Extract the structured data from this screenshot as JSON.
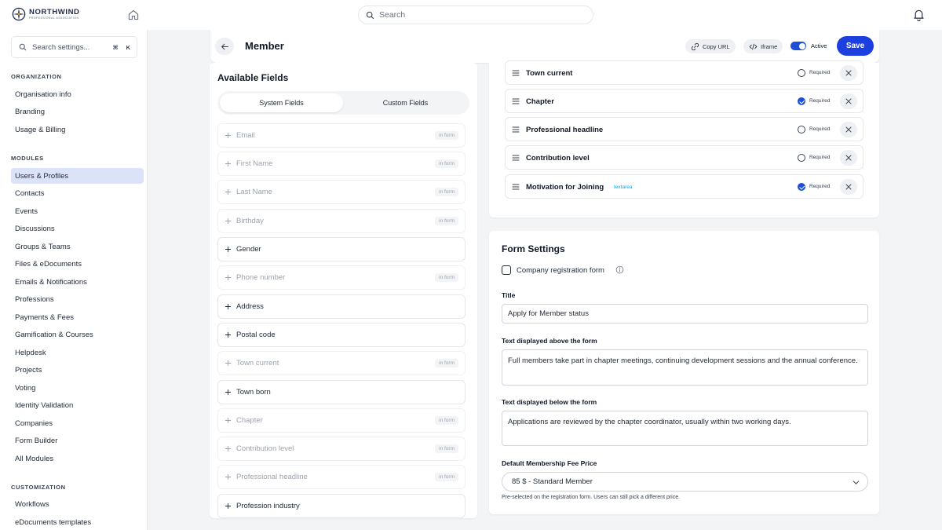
{
  "brand": {
    "name": "NORTHWIND",
    "tagline": "PROFESSIONAL ASSOCIATION"
  },
  "topbar": {
    "search_placeholder": "Search"
  },
  "sidebar": {
    "search_placeholder": "Search settings...",
    "shortcut": [
      "⌘",
      "K"
    ],
    "sections": [
      {
        "heading": "ORGANIZATION",
        "items": [
          "Organisation info",
          "Branding",
          "Usage & Billing"
        ]
      },
      {
        "heading": "MODULES",
        "items": [
          "Users & Profiles",
          "Contacts",
          "Events",
          "Discussions",
          "Groups & Teams",
          "Files & eDocuments",
          "Emails & Notifications",
          "Professions",
          "Payments & Fees",
          "Gamification & Courses",
          "Helpdesk",
          "Projects",
          "Voting",
          "Identity Validation",
          "Companies",
          "Form Builder",
          "All Modules"
        ]
      },
      {
        "heading": "CUSTOMIZATION",
        "items": [
          "Workflows",
          "eDocuments templates"
        ]
      }
    ],
    "active_item": "Users & Profiles"
  },
  "header": {
    "title": "Member",
    "copy_url_label": "Copy URL",
    "iframe_label": "Iframe",
    "active_label": "Active",
    "active": true,
    "save_label": "Save"
  },
  "available": {
    "title": "Available Fields",
    "tabs": [
      "System Fields",
      "Custom Fields"
    ],
    "active_tab": "System Fields",
    "in_form_label": "in form",
    "fields": [
      {
        "label": "Email",
        "in_form": true
      },
      {
        "label": "First Name",
        "in_form": true
      },
      {
        "label": "Last Name",
        "in_form": true
      },
      {
        "label": "Birthday",
        "in_form": true
      },
      {
        "label": "Gender",
        "in_form": false
      },
      {
        "label": "Phone number",
        "in_form": true
      },
      {
        "label": "Address",
        "in_form": false
      },
      {
        "label": "Postal code",
        "in_form": false
      },
      {
        "label": "Town current",
        "in_form": true
      },
      {
        "label": "Town born",
        "in_form": false
      },
      {
        "label": "Chapter",
        "in_form": true
      },
      {
        "label": "Contribution level",
        "in_form": true
      },
      {
        "label": "Professional headline",
        "in_form": true
      },
      {
        "label": "Profession industry",
        "in_form": false
      }
    ]
  },
  "selected": {
    "required_label": "Required",
    "fields": [
      {
        "label": "Town current",
        "tag": "",
        "required": false
      },
      {
        "label": "Chapter",
        "tag": "",
        "required": true
      },
      {
        "label": "Professional headline",
        "tag": "",
        "required": false
      },
      {
        "label": "Contribution level",
        "tag": "",
        "required": false
      },
      {
        "label": "Motivation for Joining",
        "tag": "textarea",
        "required": true
      }
    ]
  },
  "form_settings": {
    "title": "Form Settings",
    "company_checkbox_label": "Company registration form",
    "company_checked": false,
    "title_label": "Title",
    "title_value": "Apply for Member status",
    "above_label": "Text displayed above the form",
    "above_value": "Full members take part in chapter meetings, continuing development sessions and the annual conference.",
    "below_label": "Text displayed below the form",
    "below_value": "Applications are reviewed by the chapter coordinator, usually within two working days.",
    "fee_label": "Default Membership Fee Price",
    "fee_value": "85 $ - Standard Member",
    "fee_help": "Pre-selected on the registration form. Users can still pick a different price."
  },
  "colors": {
    "accent": "#1d3fe0",
    "active_bg": "#dbe3fb",
    "tag": "#0ea5e9"
  }
}
